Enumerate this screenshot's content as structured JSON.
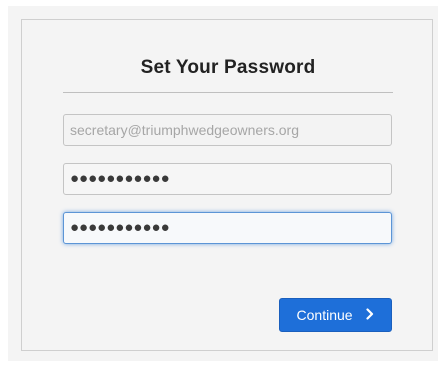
{
  "form": {
    "title": "Set Your Password",
    "email_value": "secretary@triumphwedgeowners.org",
    "password_value": "●●●●●●●●●●●",
    "confirm_value": "●●●●●●●●●●●",
    "continue_label": "Continue",
    "continue_icon": "chevron-right-icon"
  },
  "colors": {
    "button": "#1e6fd9",
    "focus_border": "#5c95d6",
    "card_background": "#f4f4f4"
  }
}
